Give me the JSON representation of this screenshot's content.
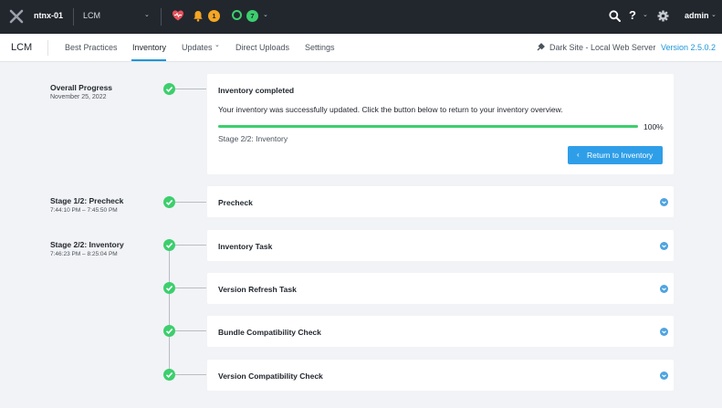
{
  "topbar": {
    "cluster": "ntnx-01",
    "app": "LCM",
    "alerts_count": "1",
    "tasks_count": "7",
    "user": "admin"
  },
  "subnav": {
    "title": "LCM",
    "tabs": [
      {
        "label": "Best Practices"
      },
      {
        "label": "Inventory"
      },
      {
        "label": "Updates"
      },
      {
        "label": "Direct Uploads"
      },
      {
        "label": "Settings"
      }
    ],
    "updates_caret": "⌄",
    "site": "Dark Site - Local Web Server",
    "version": "Version 2.5.0.2"
  },
  "timeline": {
    "overall": {
      "label": "Overall Progress",
      "date": "November 25, 2022",
      "card_title": "Inventory completed",
      "message": "Your inventory was successfully updated. Click the button below to return to your inventory overview.",
      "progress": 100,
      "progress_text": "100%",
      "stage": "Stage 2/2: Inventory",
      "button": "Return to Inventory"
    },
    "stages": [
      {
        "label": "Stage 1/2: Precheck",
        "time": "7:44:10 PM – 7:45:50 PM",
        "card_title": "Precheck"
      },
      {
        "label": "Stage 2/2: Inventory",
        "time": "7:46:23 PM – 8:25:04 PM",
        "card_title": "Inventory Task"
      }
    ],
    "subtasks": [
      {
        "card_title": "Version Refresh Task"
      },
      {
        "card_title": "Bundle Compatibility Check"
      },
      {
        "card_title": "Version Compatibility Check"
      }
    ]
  },
  "colors": {
    "topbar": "#22272e",
    "accent": "#1b97d9",
    "success": "#3ccf6d",
    "warning": "#f5a623"
  }
}
